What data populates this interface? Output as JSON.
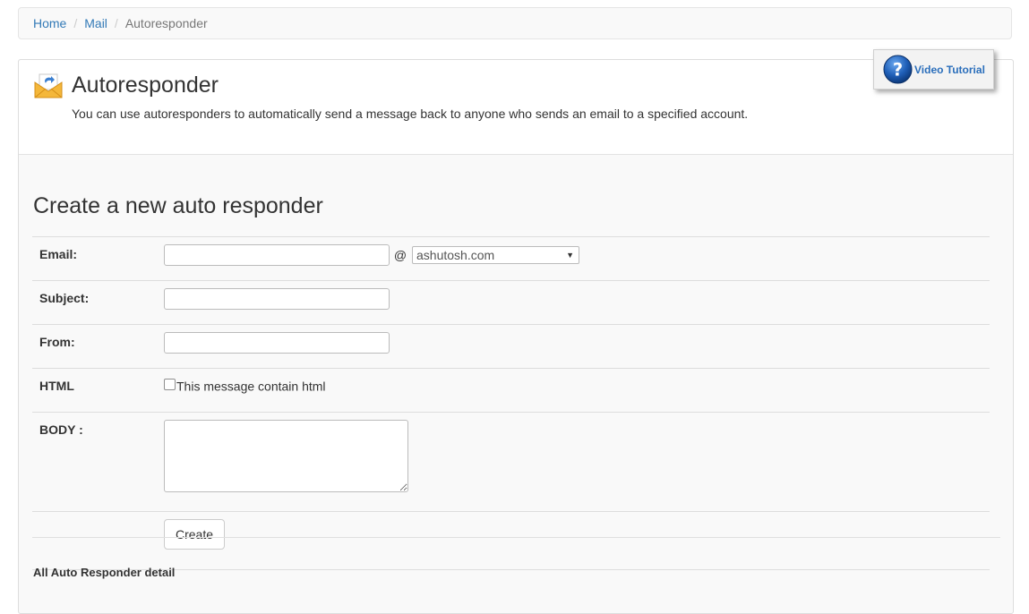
{
  "breadcrumb": {
    "items": [
      "Home",
      "Mail"
    ],
    "active": "Autoresponder",
    "separator": "/"
  },
  "header": {
    "title": "Autoresponder",
    "description": "You can use autoresponders to automatically send a message back to anyone who sends an email to a specified account.",
    "icon": "envelope-reply-icon",
    "video_button": "Video Tutorial",
    "video_icon": "help-question-icon"
  },
  "form": {
    "title": "Create a new auto responder",
    "email_label": "Email:",
    "email_value": "",
    "at_sign": "@",
    "domain_selected": "ashutosh.com",
    "subject_label": "Subject:",
    "subject_value": "",
    "from_label": "From:",
    "from_value": "",
    "html_label": "HTML",
    "html_checkbox_label": "This message contain html",
    "html_checked": false,
    "body_label": "BODY :",
    "body_value": "",
    "create_button": "Create"
  },
  "list": {
    "heading": "All Auto Responder detail"
  },
  "colors": {
    "link": "#337ab7",
    "video_text": "#2a6ebb",
    "panel_bg": "#f9f9f9"
  }
}
